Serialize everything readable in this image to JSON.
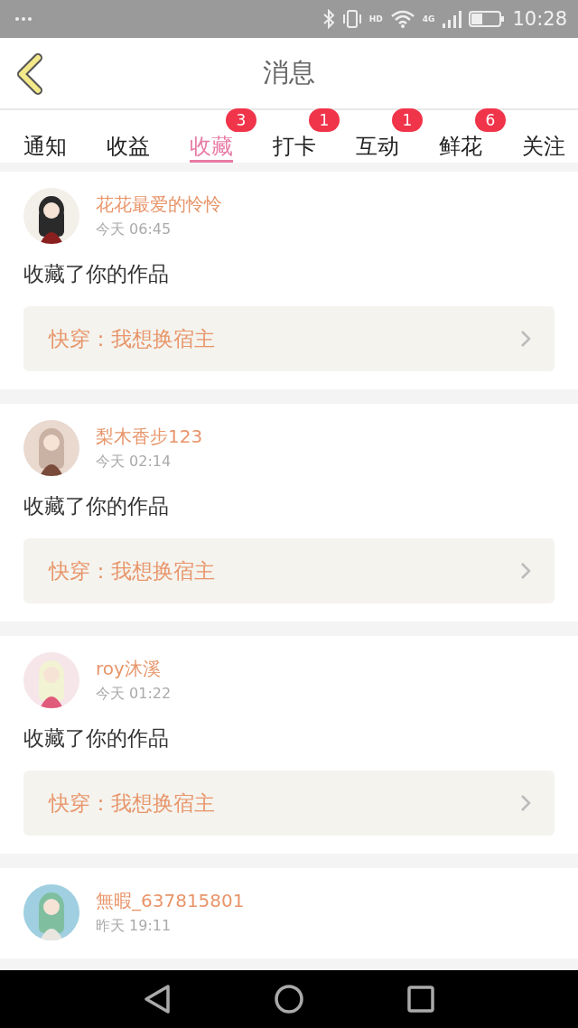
{
  "status_bar": {
    "hd": "HD",
    "network": "4G",
    "time": "10:28"
  },
  "header": {
    "title": "消息"
  },
  "tabs": [
    {
      "label": "通知",
      "selected": false
    },
    {
      "label": "收益",
      "selected": false
    },
    {
      "label": "收藏",
      "selected": true,
      "badge": "3"
    },
    {
      "label": "打卡",
      "selected": false,
      "badge": "1"
    },
    {
      "label": "互动",
      "selected": false,
      "badge": "1"
    },
    {
      "label": "鲜花",
      "selected": false,
      "badge": "6"
    },
    {
      "label": "关注",
      "selected": false
    }
  ],
  "messages": [
    {
      "user": "花花最爱的怜怜",
      "time": "今天 06:45",
      "text": "收藏了你的作品",
      "work": "快穿：我想换宿主"
    },
    {
      "user": "梨木香步123",
      "time": "今天 02:14",
      "text": "收藏了你的作品",
      "work": "快穿：我想换宿主"
    },
    {
      "user": "roy沐溪",
      "time": "今天 01:22",
      "text": "收藏了你的作品",
      "work": "快穿：我想换宿主"
    },
    {
      "user": "無暇_637815801",
      "time": "昨天 19:11"
    }
  ]
}
